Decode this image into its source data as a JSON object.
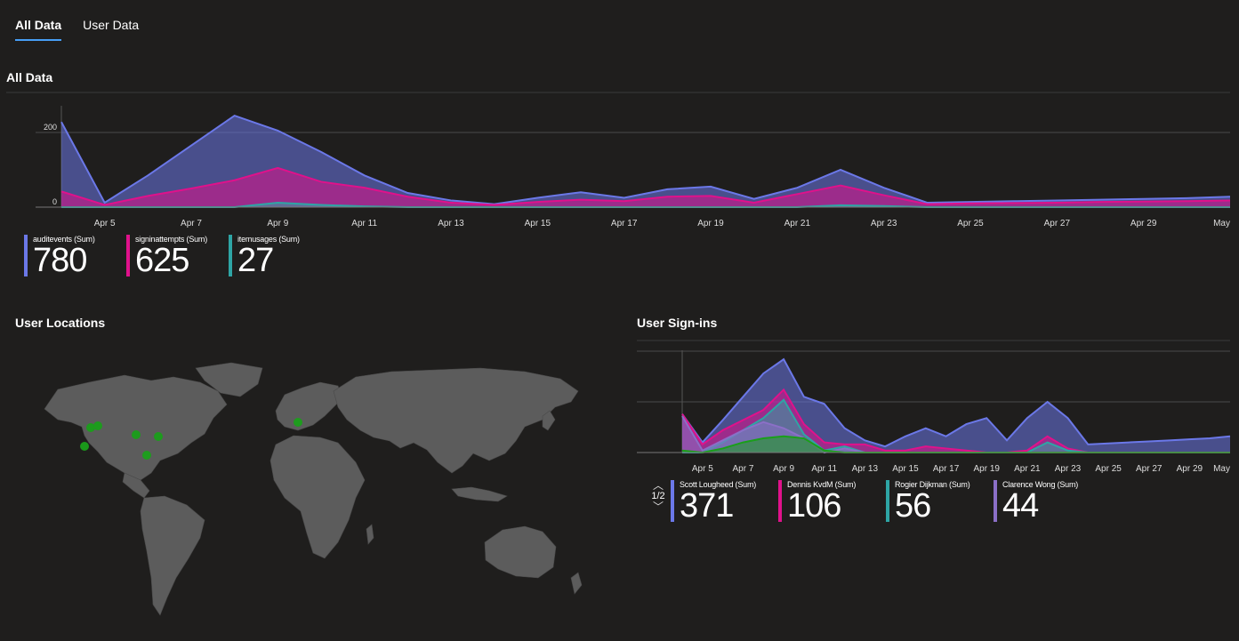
{
  "tabs": [
    {
      "label": "All Data",
      "active": true
    },
    {
      "label": "User Data",
      "active": false
    }
  ],
  "sections": {
    "all_data_title": "All Data",
    "locations_title": "User Locations",
    "signins_title": "User Sign-ins"
  },
  "colors": {
    "blue": "#6b78e8",
    "magenta": "#e0118b",
    "teal": "#2ea5a5",
    "green": "#1a9f1a",
    "lavender": "#8b6fc7",
    "background": "#1f1e1d",
    "land": "#5c5c5c"
  },
  "chart_data": [
    {
      "type": "area",
      "x": [
        "Apr 4",
        "Apr 5",
        "Apr 6",
        "Apr 7",
        "Apr 8",
        "Apr 9",
        "Apr 10",
        "Apr 11",
        "Apr 12",
        "Apr 13",
        "Apr 14",
        "Apr 15",
        "Apr 16",
        "Apr 17",
        "Apr 18",
        "Apr 19",
        "Apr 20",
        "Apr 21",
        "Apr 22",
        "Apr 23",
        "Apr 24",
        "Apr 25",
        "Apr 26",
        "Apr 27",
        "Apr 28",
        "Apr 29",
        "Apr 30",
        "May"
      ],
      "tick_labels": [
        "Apr 5",
        "Apr 7",
        "Apr 9",
        "Apr 11",
        "Apr 13",
        "Apr 15",
        "Apr 17",
        "Apr 19",
        "Apr 21",
        "Apr 23",
        "Apr 25",
        "Apr 27",
        "Apr 29",
        "May"
      ],
      "yticks": [
        0,
        200
      ],
      "ylim": [
        0,
        300
      ],
      "grid": true,
      "series": [
        {
          "name": "auditevents (Sum)",
          "color": "#6b78e8",
          "values": [
            228,
            12,
            85,
            165,
            245,
            205,
            148,
            85,
            38,
            18,
            8,
            25,
            40,
            25,
            48,
            55,
            22,
            52,
            100,
            52,
            12,
            14,
            16,
            18,
            20,
            22,
            24,
            28
          ]
        },
        {
          "name": "signinattempts (Sum)",
          "color": "#e0118b",
          "values": [
            42,
            6,
            30,
            50,
            72,
            105,
            68,
            52,
            28,
            12,
            6,
            14,
            20,
            16,
            28,
            30,
            12,
            35,
            58,
            32,
            8,
            10,
            11,
            12,
            14,
            15,
            16,
            18
          ]
        },
        {
          "name": "itemusages (Sum)",
          "color": "#2ea5a5",
          "values": [
            0,
            0,
            0,
            0,
            0,
            12,
            6,
            2,
            0,
            0,
            0,
            0,
            0,
            0,
            0,
            0,
            0,
            0,
            5,
            3,
            0,
            0,
            0,
            0,
            0,
            0,
            0,
            0
          ]
        }
      ]
    },
    {
      "type": "area",
      "x": [
        "Apr 4",
        "Apr 5",
        "Apr 6",
        "Apr 7",
        "Apr 8",
        "Apr 9",
        "Apr 10",
        "Apr 11",
        "Apr 12",
        "Apr 13",
        "Apr 14",
        "Apr 15",
        "Apr 16",
        "Apr 17",
        "Apr 18",
        "Apr 19",
        "Apr 20",
        "Apr 21",
        "Apr 22",
        "Apr 23",
        "Apr 24",
        "Apr 25",
        "Apr 26",
        "Apr 27",
        "Apr 28",
        "Apr 29",
        "Apr 30",
        "May"
      ],
      "tick_labels": [
        "Apr 5",
        "Apr 7",
        "Apr 9",
        "Apr 11",
        "Apr 13",
        "Apr 15",
        "Apr 17",
        "Apr 19",
        "Apr 21",
        "Apr 23",
        "Apr 25",
        "Apr 27",
        "Apr 29",
        "May"
      ],
      "yticks": [
        0,
        50,
        100
      ],
      "ylim": [
        0,
        100
      ],
      "grid": true,
      "series": [
        {
          "name": "Scott Lougheed (Sum)",
          "color": "#6b78e8",
          "values": [
            38,
            10,
            32,
            55,
            78,
            92,
            55,
            48,
            24,
            12,
            6,
            16,
            24,
            16,
            28,
            34,
            12,
            34,
            50,
            34,
            8,
            9,
            10,
            11,
            12,
            13,
            14,
            16
          ]
        },
        {
          "name": "Dennis KvdM (Sum)",
          "color": "#e0118b",
          "values": [
            38,
            8,
            22,
            32,
            42,
            62,
            28,
            10,
            8,
            8,
            2,
            2,
            6,
            4,
            2,
            0,
            0,
            2,
            16,
            4,
            0,
            0,
            0,
            0,
            0,
            0,
            0,
            0
          ]
        },
        {
          "name": "Rogier Dijkman (Sum)",
          "color": "#2ea5a5",
          "values": [
            0,
            0,
            10,
            22,
            34,
            52,
            18,
            2,
            6,
            0,
            0,
            0,
            0,
            0,
            0,
            0,
            0,
            0,
            10,
            2,
            0,
            0,
            0,
            0,
            0,
            0,
            0,
            0
          ]
        },
        {
          "name": "Clarence Wong (Sum)",
          "color": "#8b6fc7",
          "values": [
            36,
            2,
            12,
            22,
            30,
            24,
            14,
            0,
            4,
            0,
            0,
            0,
            0,
            0,
            0,
            0,
            0,
            0,
            0,
            0,
            0,
            0,
            0,
            0,
            0,
            0,
            0,
            0
          ]
        },
        {
          "name": "",
          "color": "#1a9f1a",
          "values": [
            2,
            0,
            4,
            10,
            14,
            16,
            14,
            2,
            0,
            0,
            0,
            0,
            0,
            0,
            0,
            0,
            0,
            0,
            0,
            0,
            0,
            0,
            0,
            0,
            0,
            0,
            0,
            0
          ]
        }
      ]
    }
  ],
  "legend_top": [
    {
      "label": "auditevents (Sum)",
      "value": "780",
      "color": "#6b78e8"
    },
    {
      "label": "signinattempts (Sum)",
      "value": "625",
      "color": "#e0118b"
    },
    {
      "label": "itemusages (Sum)",
      "value": "27",
      "color": "#2ea5a5"
    }
  ],
  "legend_signins": [
    {
      "label": "Scott Lougheed (Sum)",
      "value": "371",
      "color": "#6b78e8"
    },
    {
      "label": "Dennis KvdM (Sum)",
      "value": "106",
      "color": "#e0118b"
    },
    {
      "label": "Rogier Dijkman (Sum)",
      "value": "56",
      "color": "#2ea5a5"
    },
    {
      "label": "Clarence Wong (Sum)",
      "value": "44",
      "color": "#8b6fc7"
    }
  ],
  "pager": {
    "text": "1/2"
  },
  "map": {
    "markers": [
      {
        "name": "Seattle"
      },
      {
        "name": "Vancouver"
      },
      {
        "name": "San Francisco"
      },
      {
        "name": "Denver"
      },
      {
        "name": "Chicago"
      },
      {
        "name": "Atlanta"
      },
      {
        "name": "Amsterdam"
      }
    ]
  }
}
